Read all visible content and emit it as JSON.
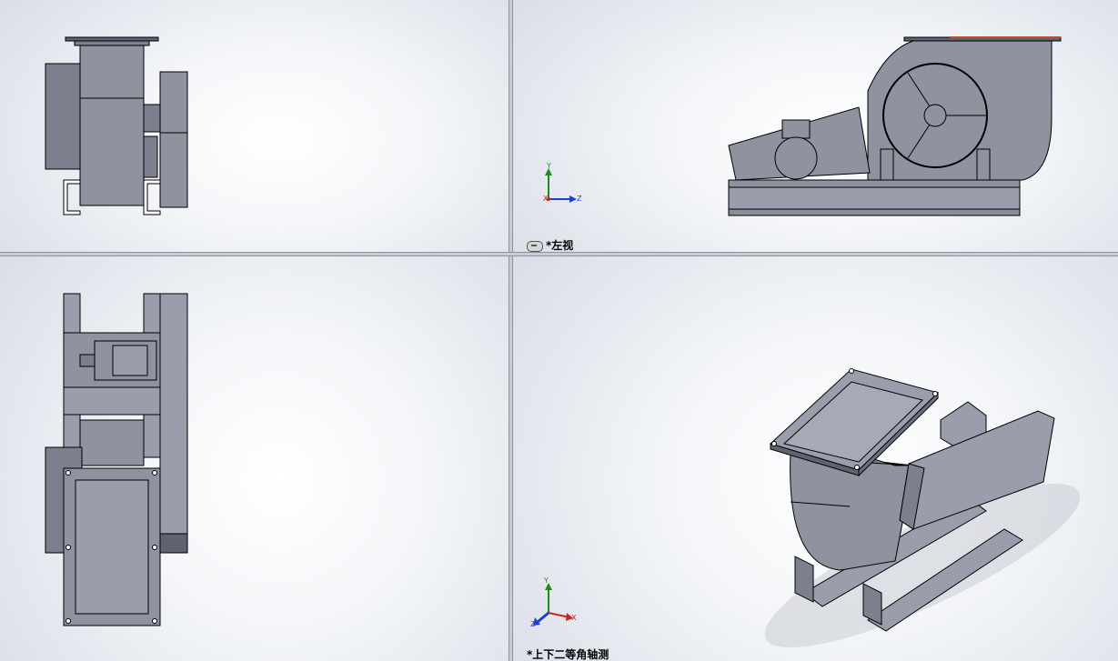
{
  "viewports": {
    "top_left": {
      "label": ""
    },
    "top_right": {
      "label": "*左视",
      "link_icon": "link-icon"
    },
    "bottom_left": {
      "label": ""
    },
    "bottom_right": {
      "label": "*上下二等角轴测"
    }
  },
  "axes": {
    "x": "X",
    "y": "Y",
    "z": "Z",
    "colors": {
      "x": "#d02020",
      "y": "#1f8a1f",
      "z": "#1f3fd0"
    }
  },
  "colors": {
    "part_face": "#8f929f",
    "part_dark": "#6d7080",
    "part_edge": "#000000",
    "accent_flange": "#c05020"
  }
}
